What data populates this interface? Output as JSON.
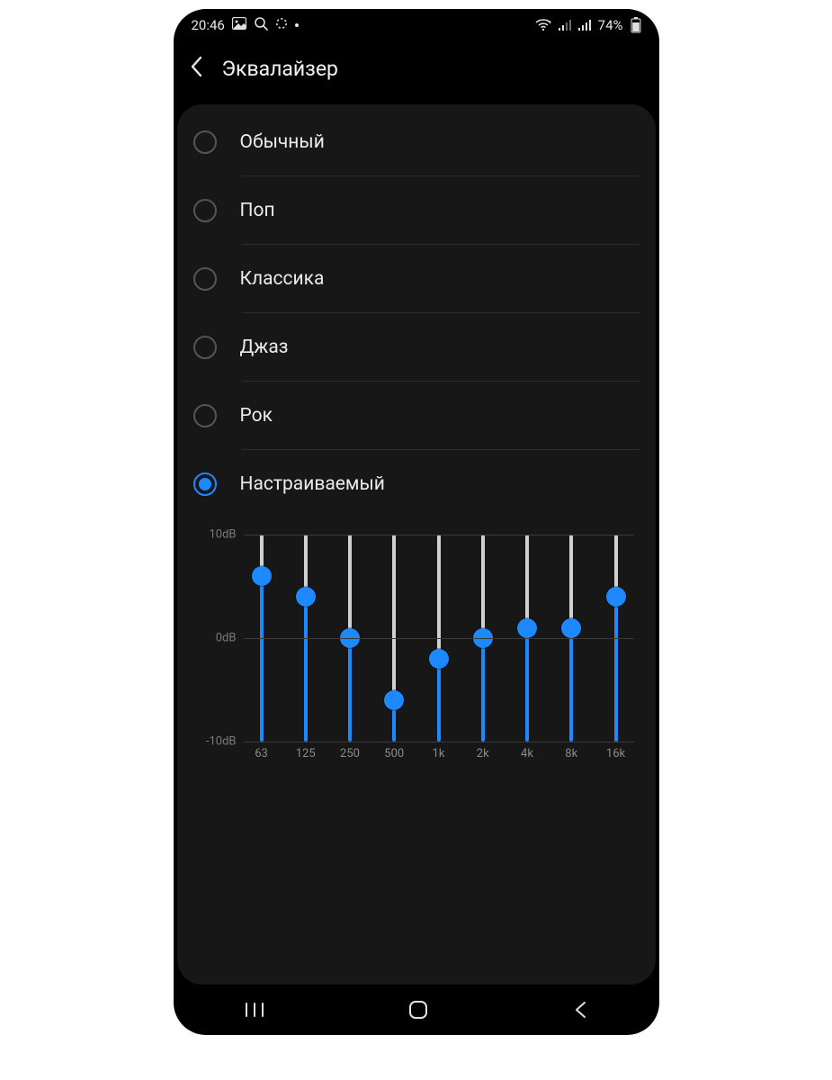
{
  "statusbar": {
    "time": "20:46",
    "battery": "74%"
  },
  "header": {
    "title": "Эквалайзер"
  },
  "presets": [
    {
      "label": "Обычный",
      "selected": false
    },
    {
      "label": "Поп",
      "selected": false
    },
    {
      "label": "Классика",
      "selected": false
    },
    {
      "label": "Джаз",
      "selected": false
    },
    {
      "label": "Рок",
      "selected": false
    },
    {
      "label": "Настраиваемый",
      "selected": true
    }
  ],
  "chart_data": {
    "type": "bar",
    "categories": [
      "63",
      "125",
      "250",
      "500",
      "1k",
      "2k",
      "4k",
      "8k",
      "16k"
    ],
    "values": [
      6,
      4,
      0,
      -6,
      -2,
      0,
      1,
      1,
      4
    ],
    "ylim": [
      -10,
      10
    ],
    "yticks": [
      {
        "value": 10,
        "label": "10dB"
      },
      {
        "value": 0,
        "label": "0dB"
      },
      {
        "value": -10,
        "label": "-10dB"
      }
    ],
    "ylabel": "",
    "xlabel": "",
    "title": ""
  },
  "colors": {
    "accent": "#1e88ff",
    "card": "#171717",
    "bg": "#000000",
    "text": "#eaeaea",
    "muted": "#7a7a7a"
  }
}
